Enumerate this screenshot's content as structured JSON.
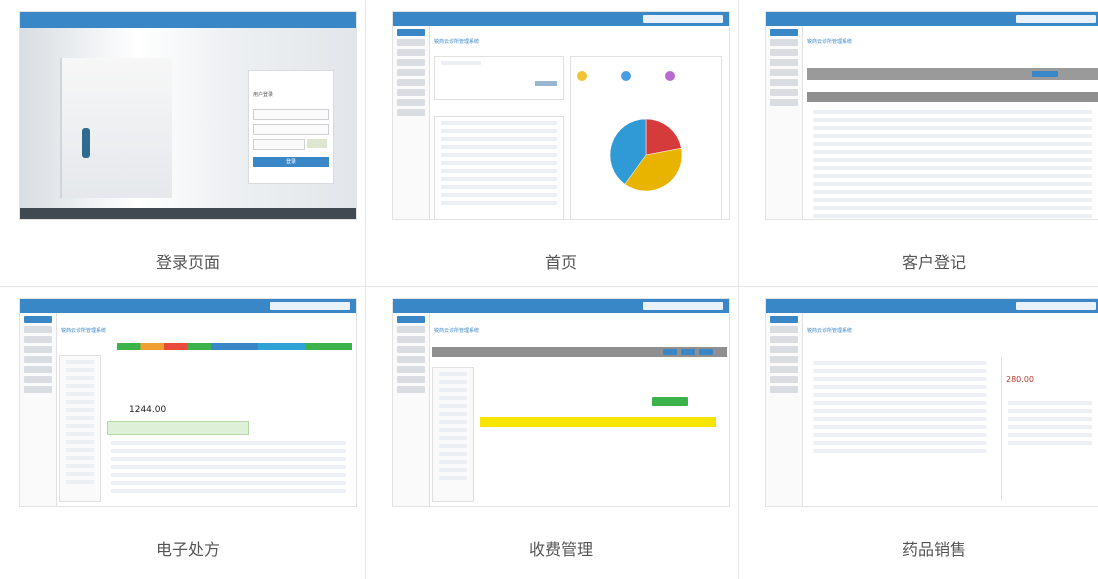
{
  "screenshots": [
    {
      "caption": "登录页面",
      "login": {
        "title": "用户登录",
        "button": "登录"
      }
    },
    {
      "caption": "首页",
      "header": "锐商云诊所管理系统"
    },
    {
      "caption": "客户登记",
      "header": "锐商云诊所管理系统"
    },
    {
      "caption": "电子处方",
      "header": "锐商云诊所管理系统",
      "amount": "1244.00"
    },
    {
      "caption": "收费管理",
      "header": "锐商云诊所管理系统"
    },
    {
      "caption": "药品销售",
      "header": "锐商云诊所管理系统",
      "total": "280.00"
    }
  ],
  "pie": {
    "slices": [
      {
        "value": 0.22,
        "color": "#d63b3b"
      },
      {
        "value": 0.38,
        "color": "#e8b400"
      },
      {
        "value": 0.4,
        "color": "#2f9ad6"
      }
    ]
  },
  "colors": {
    "accent": "#3a87c8",
    "green": "#3bb34a",
    "yellow": "#f6e500"
  }
}
